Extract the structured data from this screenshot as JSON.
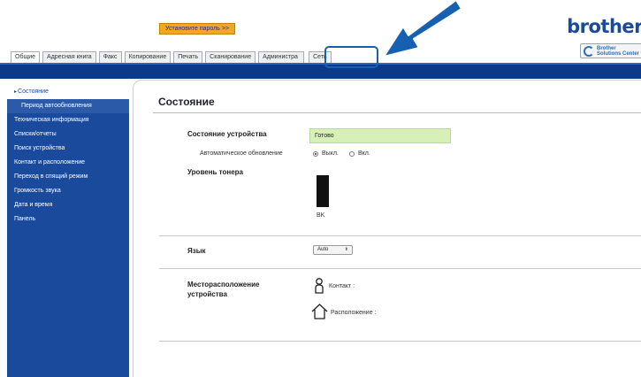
{
  "header": {
    "set_password_label": "Установите пароль >>",
    "brand": "brother",
    "solutions_center": {
      "line1": "Brother",
      "line2": "Solutions Center"
    }
  },
  "tabs": [
    {
      "label": "Общие",
      "active": true
    },
    {
      "label": "Адресная книга"
    },
    {
      "label": "Факс"
    },
    {
      "label": "Копирование"
    },
    {
      "label": "Печать"
    },
    {
      "label": "Сканирование"
    },
    {
      "label": "Администратор",
      "partially_hidden": true,
      "visible_start": "Администра",
      "visible_end": "р"
    },
    {
      "label": "Сеть",
      "highlighted": true
    }
  ],
  "sidebar": {
    "items": [
      {
        "label": "Состояние",
        "active": true,
        "bullet": "▸"
      },
      {
        "label": "Период автообновления",
        "sub": true
      },
      {
        "label": "Техническая информация"
      },
      {
        "label": "Списки/отчеты"
      },
      {
        "label": "Поиск устройства"
      },
      {
        "label": "Контакт и расположение"
      },
      {
        "label": "Переход в спящий режим"
      },
      {
        "label": "Громкость звука"
      },
      {
        "label": "Дата и время"
      },
      {
        "label": "Панель"
      }
    ]
  },
  "main": {
    "title": "Состояние",
    "device_status": {
      "label": "Состояние устройства",
      "value": "Готово"
    },
    "auto_refresh": {
      "label": "Автоматическое обновление",
      "options": [
        "Выкл.",
        "Вкл."
      ],
      "selected": "Выкл."
    },
    "toner": {
      "label": "Уровень тонера",
      "color_code": "BK",
      "level": 1.0
    },
    "language": {
      "label": "Язык",
      "selected": "Auto"
    },
    "location": {
      "label_line1": "Месторасположение",
      "label_line2": "устройства",
      "contact_label": "Контакт :",
      "location_label": "Расположение :"
    }
  },
  "colors": {
    "nav_blue": "#1a4a9c",
    "bar_blue": "#0c3a8a",
    "status_ok": "#d6f0b8",
    "password_button": "#f5a623",
    "annotation_blue": "#1560b0"
  }
}
